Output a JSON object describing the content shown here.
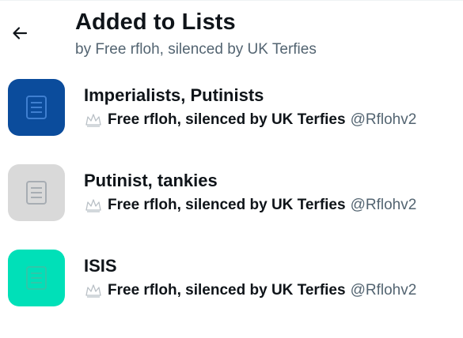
{
  "header": {
    "title": "Added to Lists",
    "subtitle": "by Free rfloh, silenced by UK Terfies",
    "back_icon": "arrow-left-icon"
  },
  "lists": [
    {
      "name": "Imperialists, Putinists",
      "owner_name": "Free rfloh, silenced by UK Terfies",
      "owner_handle": "@Rflohv2",
      "thumb_color": "#0b4c9c",
      "icon": "list-document-icon",
      "icon_color": "#3f7fd0"
    },
    {
      "name": "Putinist, tankies",
      "owner_name": "Free rfloh, silenced by UK Terfies",
      "owner_handle": "@Rflohv2",
      "thumb_color": "#d9d9d9",
      "icon": "list-document-icon",
      "icon_color": "#a7adb3"
    },
    {
      "name": "ISIS",
      "owner_name": "Free rfloh, silenced by UK Terfies",
      "owner_handle": "@Rflohv2",
      "thumb_color": "#00e0b8",
      "icon": "list-document-icon",
      "icon_color": "#2fc7a9"
    }
  ]
}
